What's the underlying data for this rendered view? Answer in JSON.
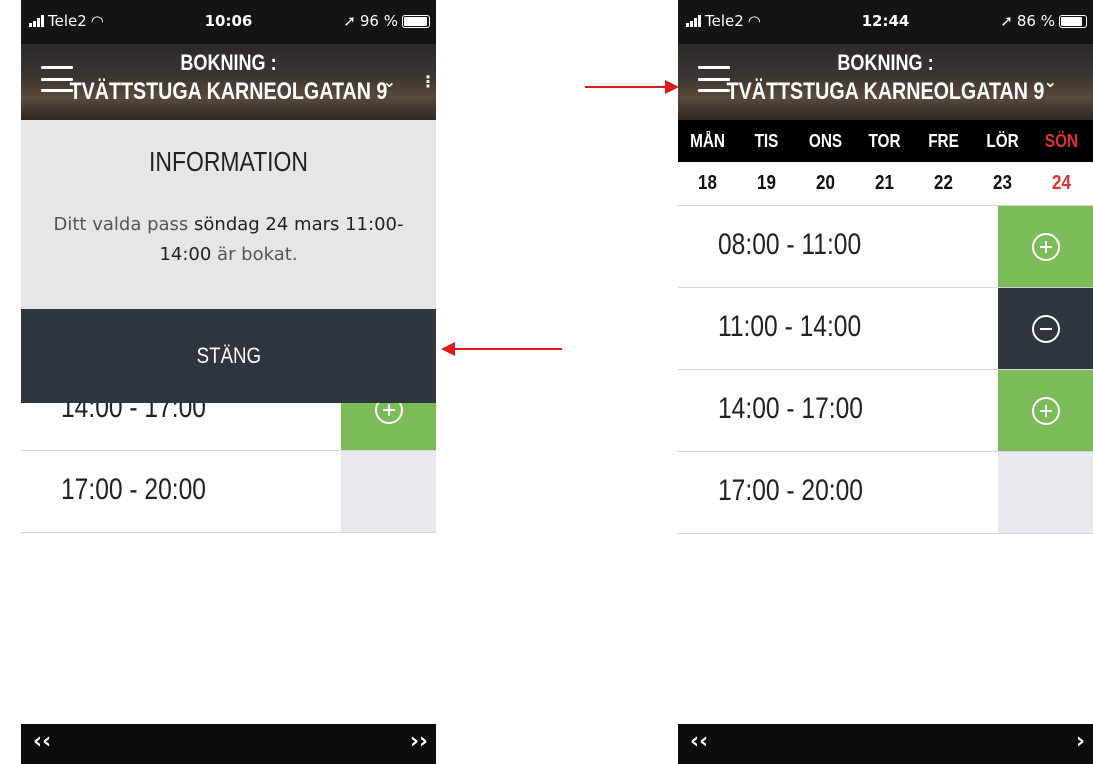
{
  "left": {
    "status": {
      "carrier": "Tele2",
      "time": "10:06",
      "battery": "96 %"
    },
    "header": {
      "line1": "BOKNING :",
      "line2": "TVÄTTSTUGA KARNEOLGATAN 9"
    },
    "modal": {
      "title": "INFORMATION",
      "text_pre": "Ditt valda pass ",
      "text_bold": "söndag 24 mars 11:00-14:00",
      "text_post": " är bokat.",
      "close_label": "STÄNG"
    },
    "slots": [
      {
        "time": "14:00 - 17:00",
        "state": "available"
      },
      {
        "time": "17:00 - 20:00",
        "state": "unavailable"
      }
    ],
    "nav": {
      "prev": "‹‹",
      "next": "››"
    }
  },
  "right": {
    "status": {
      "carrier": "Tele2",
      "time": "12:44",
      "battery": "86 %"
    },
    "header": {
      "line1": "BOKNING :",
      "line2": "TVÄTTSTUGA KARNEOLGATAN 9"
    },
    "days": [
      "MÅN",
      "TIS",
      "ONS",
      "TOR",
      "FRE",
      "LÖR",
      "SÖN"
    ],
    "dates": [
      "18",
      "19",
      "20",
      "21",
      "22",
      "23",
      "24"
    ],
    "slots": [
      {
        "time": "08:00 - 11:00",
        "state": "available"
      },
      {
        "time": "11:00 - 14:00",
        "state": "booked"
      },
      {
        "time": "14:00 - 17:00",
        "state": "available"
      },
      {
        "time": "17:00 - 20:00",
        "state": "unavailable"
      }
    ],
    "nav": {
      "prev": "‹‹",
      "next": "›"
    }
  },
  "colors": {
    "available": "#7bbb58",
    "booked": "#2f363d",
    "unavailable": "#e8e9ec",
    "sunday": "#e03030",
    "annotation_arrow": "#e01818"
  }
}
